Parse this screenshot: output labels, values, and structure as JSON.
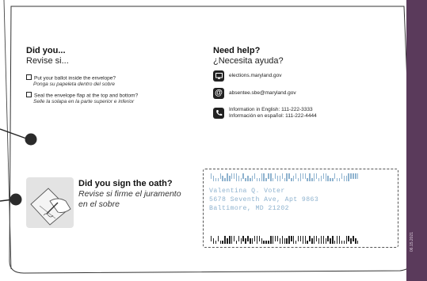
{
  "did_you": {
    "heading": "Did you...",
    "subheading": "Revise si...",
    "items": [
      {
        "en": "Put your ballot inside the envelope?",
        "es": "Ponga su papeleta dentro del sobre"
      },
      {
        "en": "Seal the envelope flap at the top and bottom?",
        "es": "Selle la solapa en la parte superior e inferior"
      }
    ]
  },
  "help": {
    "heading": "Need help?",
    "subheading": "¿Necesita ayuda?",
    "website": "elections.maryland.gov",
    "email": "absentee.sbe@maryland.gov",
    "phone_en": "Information in English: 111-222-3333",
    "phone_es": "Información en español: 111-222-4444",
    "icons": [
      "computer-icon",
      "at-sign-icon",
      "phone-icon"
    ]
  },
  "oath": {
    "title": "Did you sign the oath?",
    "es": "Revise si firme el juramento en el sobre"
  },
  "address": {
    "name": "Valentina Q. Voter",
    "street": "5678 Seventh Ave, Apt 9863",
    "city": "Baltimore, MD 21202"
  },
  "stripe_text": "06.15.2021",
  "colors": {
    "stripe": "#5a3a5b",
    "address_blue": "#8fb3cf",
    "dark": "#222222"
  }
}
